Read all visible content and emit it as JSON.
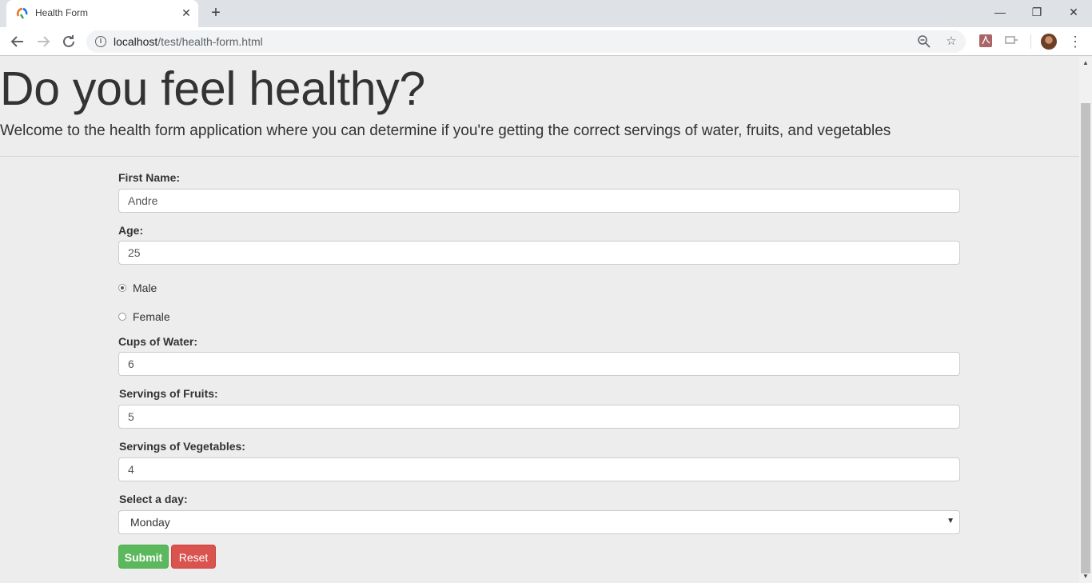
{
  "browser": {
    "tab_title": "Health Form",
    "tab_close_icon": "close-icon",
    "new_tab_symbol": "+",
    "url_host": "localhost",
    "url_path": "/test/health-form.html",
    "window_controls": {
      "minimize": "—",
      "restore": "❐",
      "close": "✕"
    }
  },
  "page": {
    "heading": "Do you feel healthy?",
    "lead": "Welcome to the health form application where you can determine if you're getting the correct servings of water, fruits, and vegetables"
  },
  "form": {
    "first_name_label": "First Name:",
    "first_name_value": "Andre",
    "age_label": "Age:",
    "age_value": "25",
    "gender_options": [
      {
        "label": "Male",
        "checked": true
      },
      {
        "label": "Female",
        "checked": false
      }
    ],
    "water_label": "Cups of Water:",
    "water_value": "6",
    "fruits_label": "Servings of Fruits:",
    "fruits_value": "5",
    "vegetables_label": "Servings of Vegetables:",
    "vegetables_value": "4",
    "day_label": "Select a day:",
    "day_value": "Monday",
    "submit_label": "Submit",
    "reset_label": "Reset"
  },
  "colors": {
    "submit": "#5cb85c",
    "reset": "#d9534f",
    "page_background": "#ededed"
  }
}
